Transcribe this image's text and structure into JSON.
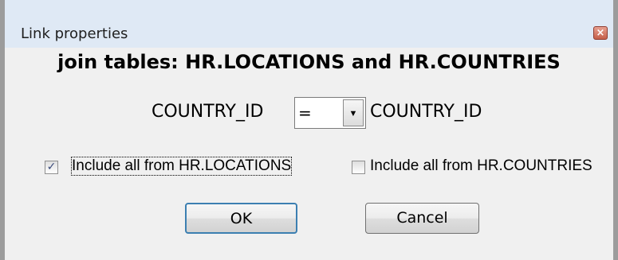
{
  "window": {
    "title": "Link properties",
    "close_label": "×"
  },
  "heading": "join tables: HR.LOCATIONS and HR.COUNTRIES",
  "join": {
    "left_column": "COUNTRY_ID",
    "operator": "=",
    "right_column": "COUNTRY_ID",
    "dropdown_arrow": "▼"
  },
  "options": [
    {
      "label": "Include all from HR.LOCATIONS",
      "checked": true,
      "mark": "✓"
    },
    {
      "label": "Include all from HR.COUNTRIES",
      "checked": false,
      "mark": ""
    }
  ],
  "buttons": {
    "ok": "OK",
    "cancel": "Cancel"
  },
  "colors": {
    "titlebar": "#dfe9f5",
    "client": "#f0f0f0",
    "focus_border": "#3c7fb1"
  }
}
